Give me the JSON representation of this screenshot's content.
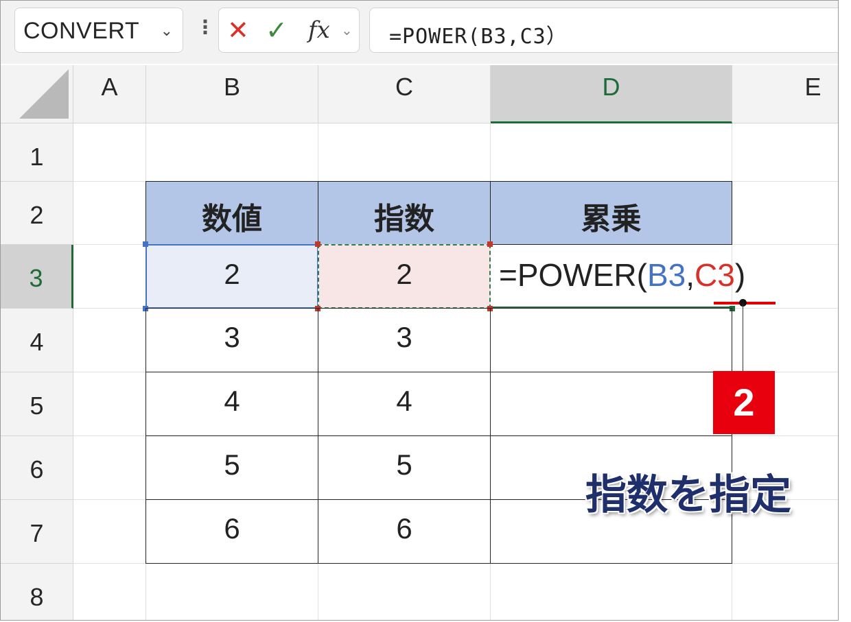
{
  "formula_bar": {
    "name_box": "CONVERT",
    "name_box_caret": "⌄",
    "more_icon": "⋮",
    "cancel_icon": "✕",
    "enter_icon": "✓",
    "fx_label": "fx",
    "fx_caret": "⌄",
    "formula": "=POWER(B3,C3）"
  },
  "columns": [
    "A",
    "B",
    "C",
    "D",
    "E"
  ],
  "rows": [
    "1",
    "2",
    "3",
    "4",
    "5",
    "6",
    "7",
    "8"
  ],
  "table": {
    "headers": [
      "数値",
      "指数",
      "累乗"
    ],
    "rows": [
      [
        "2",
        "2",
        ""
      ],
      [
        "3",
        "3",
        ""
      ],
      [
        "4",
        "4",
        ""
      ],
      [
        "5",
        "5",
        ""
      ],
      [
        "6",
        "6",
        ""
      ]
    ]
  },
  "editing_cell": {
    "prefix": "=POWER(",
    "ref1": "B3",
    "comma": ",",
    "ref2": "C3",
    "suffix": ")"
  },
  "annotation": {
    "step_number": "2",
    "note": "指数を指定",
    "badge_color": "#e8000f",
    "note_color": "#1f2f6b"
  },
  "colors": {
    "header_fill": "#b4c6e7",
    "ref1_color": "#4472c4",
    "ref2_color": "#d9312a",
    "selection_green": "#1e6b3a"
  }
}
